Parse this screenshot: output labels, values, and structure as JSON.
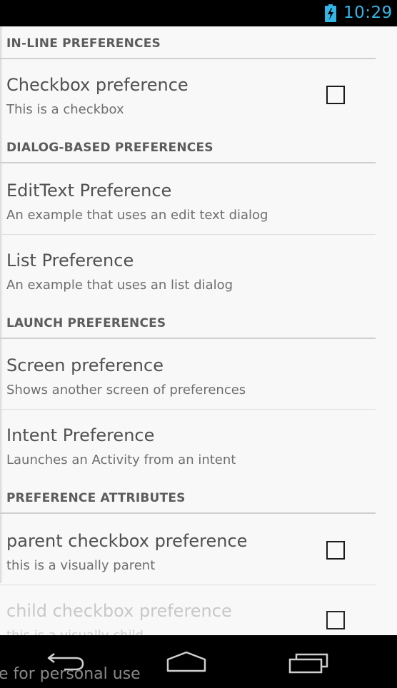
{
  "status_bar": {
    "time": "10:29",
    "battery_icon": "battery-charging-icon",
    "accent_color": "#33b5e5"
  },
  "categories": {
    "inline": "IN-LINE PREFERENCES",
    "dialog": "DIALOG-BASED PREFERENCES",
    "launch": "LAUNCH PREFERENCES",
    "attributes": "PREFERENCE ATTRIBUTES"
  },
  "prefs": {
    "checkbox": {
      "title": "Checkbox preference",
      "summary": "This is a checkbox",
      "checked": false
    },
    "edittext": {
      "title": "EditText Preference",
      "summary": "An example that uses an edit text dialog"
    },
    "list": {
      "title": "List Preference",
      "summary": "An example that uses an list dialog"
    },
    "screen": {
      "title": "Screen preference",
      "summary": "Shows another screen of preferences"
    },
    "intent": {
      "title": "Intent Preference",
      "summary": "Launches an Activity from an intent"
    },
    "parent": {
      "title": "parent checkbox preference",
      "summary": "this is a visually parent",
      "checked": false
    },
    "child": {
      "title": "child checkbox preference",
      "summary": "this is a visually child",
      "checked": false,
      "enabled": false
    }
  },
  "nav_bar": {
    "back": "back-icon",
    "home": "home-icon",
    "recents": "recents-icon"
  },
  "watermark": "e for personal use"
}
